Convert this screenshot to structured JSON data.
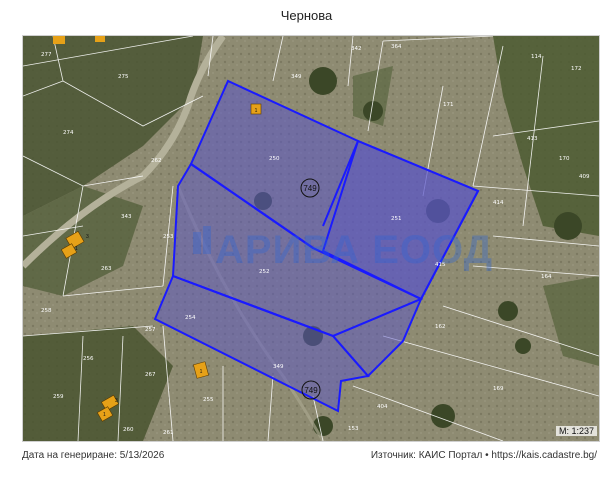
{
  "header": {
    "title": "Чернова"
  },
  "map": {
    "watermark": "АРИВА ЕООД",
    "scale": "М: 1:237",
    "parcel_labels": [
      "277",
      "275",
      "274",
      "262",
      "343",
      "263",
      "258",
      "256",
      "257",
      "259",
      "260",
      "261",
      "267",
      "255",
      "349",
      "342",
      "364",
      "171",
      "114",
      "172",
      "413",
      "170",
      "409",
      "164",
      "162",
      "414",
      "415",
      "250",
      "251",
      "252",
      "253",
      "254",
      "349",
      "404",
      "153",
      "169"
    ],
    "highlight_parcel_ids": [
      "749",
      "749"
    ],
    "building_labels": [
      "1",
      "3",
      "1",
      "1",
      "3",
      "1"
    ],
    "colors": {
      "outline": "#1a1aff",
      "fill": "#5a55c8",
      "terrain": "#8c8a6e",
      "trees": "#3d4a2c",
      "building": "#e6a118"
    }
  },
  "footer": {
    "generated": "Дата на генериране: 5/13/2026",
    "source": "Източник: КАИС Портал • https://kais.cadastre.bg/"
  }
}
